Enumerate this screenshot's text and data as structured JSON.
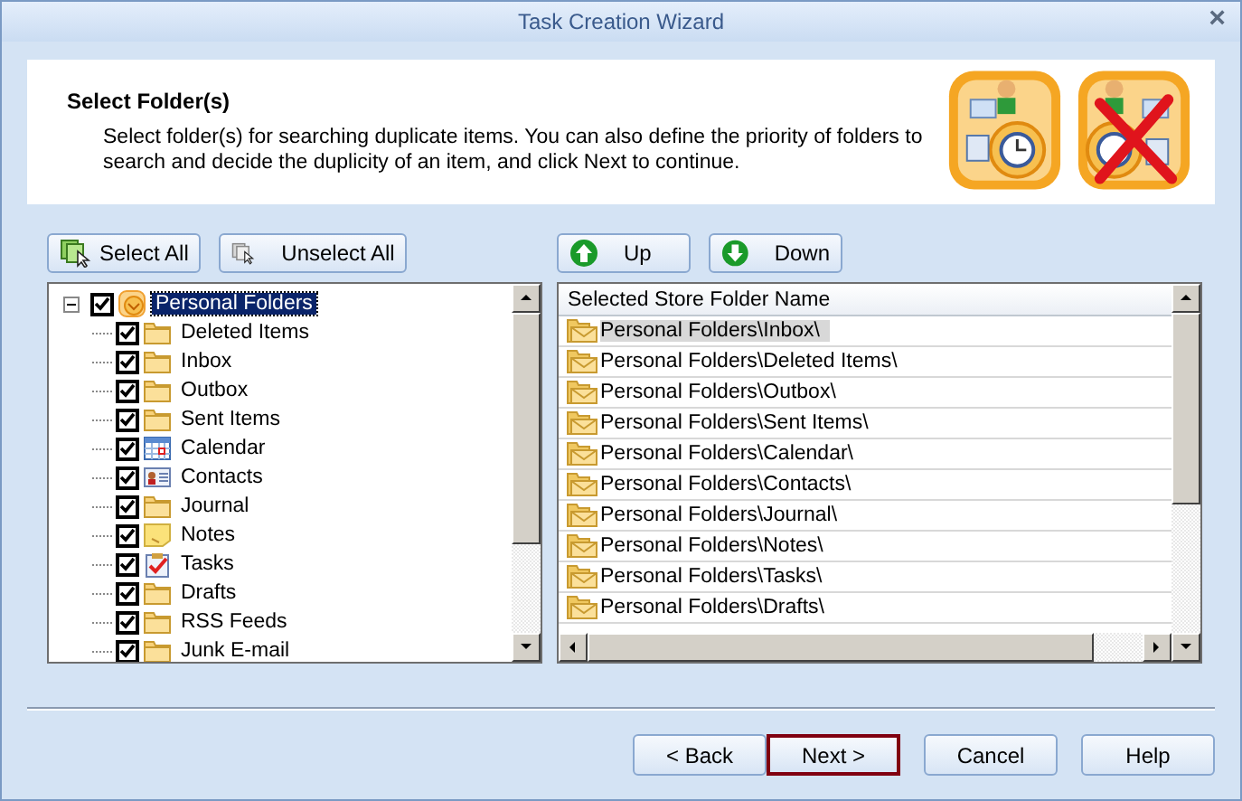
{
  "window": {
    "title": "Task Creation Wizard",
    "close": "×"
  },
  "header": {
    "title": "Select Folder(s)",
    "description": "Select folder(s) for searching duplicate items. You can also define the priority of folders to search and decide the duplicity of an item, and click Next to continue."
  },
  "left_buttons": [
    {
      "label": "Select All",
      "kind": "select"
    },
    {
      "label": "Unselect All",
      "kind": "unselect"
    }
  ],
  "tree": {
    "label": "Personal Folders",
    "checked": true,
    "expanded": true,
    "selected": true,
    "children": [
      {
        "label": "Deleted Items",
        "checked": true,
        "kind": "folder"
      },
      {
        "label": "Inbox",
        "checked": true,
        "kind": "folder"
      },
      {
        "label": "Outbox",
        "checked": true,
        "kind": "folder"
      },
      {
        "label": "Sent Items",
        "checked": true,
        "kind": "folder"
      },
      {
        "label": "Calendar",
        "checked": true,
        "kind": "calendar"
      },
      {
        "label": "Contacts",
        "checked": true,
        "kind": "contacts"
      },
      {
        "label": "Journal",
        "checked": true,
        "kind": "folder"
      },
      {
        "label": "Notes",
        "checked": true,
        "kind": "notes"
      },
      {
        "label": "Tasks",
        "checked": true,
        "kind": "tasks"
      },
      {
        "label": "Drafts",
        "checked": true,
        "kind": "folder"
      },
      {
        "label": "RSS Feeds",
        "checked": true,
        "kind": "folder"
      },
      {
        "label": "Junk E-mail",
        "checked": true,
        "kind": "folder"
      }
    ]
  },
  "right_buttons": [
    {
      "label": "Up",
      "kind": "up"
    },
    {
      "label": "Down",
      "kind": "down"
    }
  ],
  "table": {
    "column": "Selected Store Folder Name",
    "rows": [
      {
        "name": "Personal Folders\\Inbox\\",
        "selected": true
      },
      {
        "name": "Personal Folders\\Deleted Items\\",
        "selected": false
      },
      {
        "name": "Personal Folders\\Outbox\\",
        "selected": false
      },
      {
        "name": "Personal Folders\\Sent Items\\",
        "selected": false
      },
      {
        "name": "Personal Folders\\Calendar\\",
        "selected": false
      },
      {
        "name": "Personal Folders\\Contacts\\",
        "selected": false
      },
      {
        "name": "Personal Folders\\Journal\\",
        "selected": false
      },
      {
        "name": "Personal Folders\\Notes\\",
        "selected": false
      },
      {
        "name": "Personal Folders\\Tasks\\",
        "selected": false
      },
      {
        "name": "Personal Folders\\Drafts\\",
        "selected": false
      }
    ]
  },
  "footer_buttons": [
    {
      "label": "< Back",
      "focused": false
    },
    {
      "label": "Next >",
      "focused": true
    },
    {
      "label": "Cancel",
      "focused": false
    },
    {
      "label": "Help",
      "focused": false
    }
  ]
}
